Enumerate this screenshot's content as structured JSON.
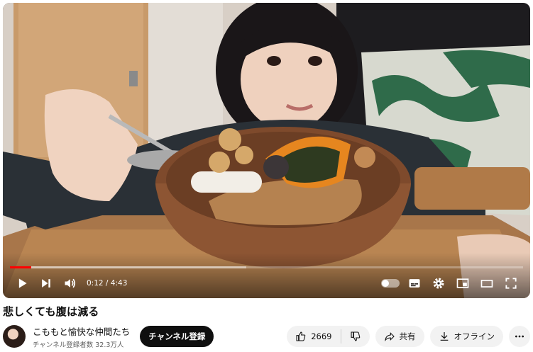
{
  "player": {
    "time_current": "0:12",
    "time_total": "4:43",
    "time_separator": " / ",
    "progress_played": 0.042,
    "progress_loaded": 0.46,
    "accent_color": "#ff0000"
  },
  "video": {
    "title": "悲しくても腹は減る"
  },
  "channel": {
    "name": "こももと愉快な仲間たち",
    "subscribers": "チャンネル登録者数 32.3万人",
    "subscribe_label": "チャンネル登録"
  },
  "actions": {
    "like_count": "2669",
    "share_label": "共有",
    "offline_label": "オフライン"
  },
  "icons": [
    "play-icon",
    "next-icon",
    "volume-icon",
    "autoplay-toggle",
    "subtitles-icon",
    "settings-icon",
    "miniplayer-icon",
    "theater-icon",
    "fullscreen-icon",
    "like-icon",
    "dislike-icon",
    "share-icon",
    "download-icon",
    "more-icon"
  ]
}
